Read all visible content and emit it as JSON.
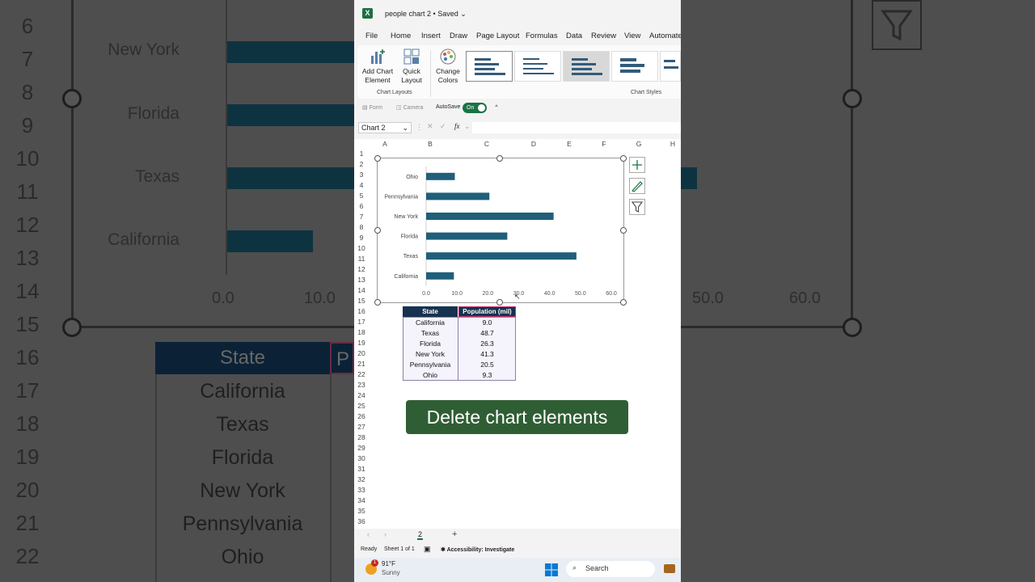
{
  "window": {
    "doc_title": "people chart 2 • Saved",
    "app_icon": "excel-icon"
  },
  "menu": [
    "File",
    "Home",
    "Insert",
    "Draw",
    "Page Layout",
    "Formulas",
    "Data",
    "Review",
    "View",
    "Automate"
  ],
  "ribbon": {
    "add_chart_element": "Add Chart Element",
    "quick_layout": "Quick Layout",
    "change_colors": "Change Colors",
    "group_chart_layouts": "Chart Layouts",
    "group_chart_styles": "Chart Styles"
  },
  "qat": {
    "form": "Form",
    "camera": "Camera",
    "autosave_label": "AutoSave",
    "autosave_state": "On"
  },
  "formula_bar": {
    "name_box": "Chart 2",
    "fx": "fx"
  },
  "grid": {
    "columns": [
      "A",
      "B",
      "C",
      "D",
      "E",
      "F",
      "G",
      "H"
    ],
    "rows": [
      "1",
      "2",
      "3",
      "4",
      "5",
      "6",
      "7",
      "8",
      "9",
      "10",
      "11",
      "12",
      "13",
      "14",
      "15",
      "16",
      "17",
      "18",
      "19",
      "20",
      "21",
      "22",
      "23",
      "24",
      "25",
      "26",
      "27",
      "28",
      "29",
      "30",
      "31",
      "32",
      "33",
      "34",
      "35",
      "36"
    ]
  },
  "chart_data": {
    "type": "bar",
    "orientation": "horizontal",
    "categories": [
      "Ohio",
      "Pennsylvania",
      "New York",
      "Florida",
      "Texas",
      "California"
    ],
    "values": [
      9.3,
      20.5,
      41.3,
      26.3,
      48.7,
      9.0
    ],
    "x_ticks": [
      "0.0",
      "10.0",
      "20.0",
      "30.0",
      "40.0",
      "50.0",
      "60.0"
    ],
    "xlim": [
      0,
      60
    ],
    "bar_color": "#1f5f7a",
    "title": "",
    "xlabel": "",
    "ylabel": "",
    "grid": false,
    "legend": "none"
  },
  "table": {
    "headers": [
      "State",
      "Population (mil)"
    ],
    "rows": [
      [
        "California",
        "9.0"
      ],
      [
        "Texas",
        "48.7"
      ],
      [
        "Florida",
        "26.3"
      ],
      [
        "New York",
        "41.3"
      ],
      [
        "Pennsylvania",
        "20.5"
      ],
      [
        "Ohio",
        "9.3"
      ]
    ]
  },
  "caption": "Delete chart elements",
  "sheet_tabs": {
    "active": "2",
    "add": "+"
  },
  "status": {
    "ready": "Ready",
    "sheet": "Sheet 1 of 1",
    "accessibility": "Accessibility: Investigate"
  },
  "taskbar": {
    "weather_temp": "91°F",
    "weather_desc": "Sunny",
    "weather_badge": "1",
    "search": "Search"
  },
  "background": {
    "row_numbers": [
      "6",
      "7",
      "8",
      "9",
      "10",
      "11",
      "12",
      "13",
      "14",
      "15",
      "16",
      "17",
      "18",
      "19",
      "20",
      "21",
      "22"
    ],
    "categories": [
      "New York",
      "Florida",
      "Texas",
      "California"
    ],
    "ticks_left": [
      "0.0",
      "10.0"
    ],
    "ticks_right": [
      "50.0",
      "60.0"
    ],
    "header": "State",
    "header2": "P",
    "cells": [
      "California",
      "Texas",
      "Florida",
      "New York",
      "Pennsylvania",
      "Ohio"
    ]
  }
}
